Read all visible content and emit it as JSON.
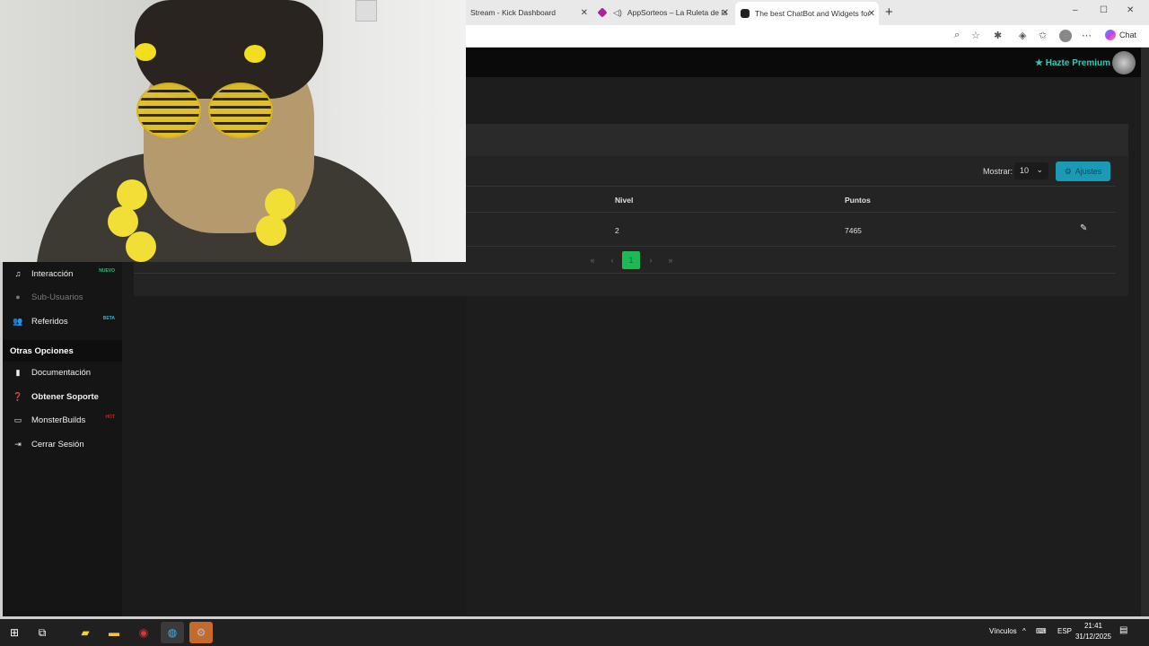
{
  "browser": {
    "tabs": [
      {
        "title": "Stream - Kick Dashboard",
        "icon": "kick-icon"
      },
      {
        "title": "AppSorteos – La Ruleta de la",
        "icon": "appsorteos-icon",
        "audio": "speaker-icon"
      },
      {
        "title": "The best ChatBot and Widgets for",
        "icon": "chatbot-icon",
        "active": true
      }
    ],
    "new_tab_label": "+",
    "window_controls": {
      "minimize": "–",
      "maximize": "☐",
      "close": "✕"
    },
    "copilot_label": "Chat"
  },
  "topnav": {
    "premium_label": "Hazte Premium",
    "premium_color": "#31c9b5"
  },
  "table_card": {
    "mostrar_label": "Mostrar:",
    "page_size": "10",
    "ajustes_label": "Ajustes",
    "columns": [
      "Nivel",
      "Puntos"
    ],
    "rows": [
      {
        "nivel": "2",
        "puntos": "7465"
      }
    ],
    "pagination": {
      "first": "«",
      "prev": "‹",
      "current": "1",
      "next": "›",
      "last": "»"
    }
  },
  "sidebar": {
    "items": [
      {
        "label": "Interacción",
        "icon": "music-icon",
        "badge": "NUEVO",
        "badge_color": "#1ec972"
      },
      {
        "label": "Sub-Usuarios",
        "icon": "users-icon",
        "disabled": true
      },
      {
        "label": "Referidos",
        "icon": "referrals-icon",
        "badge": "BETA",
        "badge_color": "#2fb4d0"
      }
    ],
    "section_title": "Otras Opciones",
    "other_items": [
      {
        "label": "Documentación",
        "icon": "book-icon"
      },
      {
        "label": "Obtener Soporte",
        "icon": "help-icon"
      },
      {
        "label": "MonsterBuilds",
        "icon": "laptop-icon",
        "badge": "HOT",
        "badge_color": "#c0262b"
      },
      {
        "label": "Cerrar Sesión",
        "icon": "logout-icon"
      }
    ]
  },
  "taskbar": {
    "tray_label": "Vínculos",
    "language": "ESP",
    "time": "21:41",
    "date": "31/12/2025"
  }
}
